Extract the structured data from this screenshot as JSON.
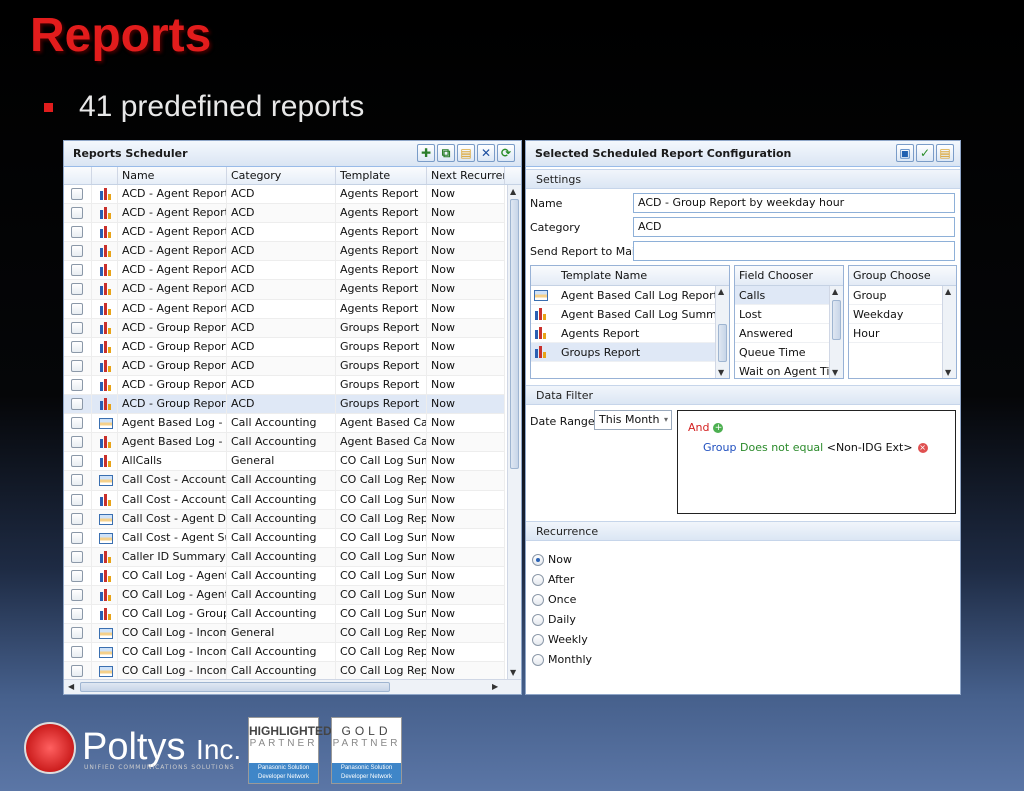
{
  "slide": {
    "title": "Reports",
    "bullet": "41 predefined reports"
  },
  "scheduler": {
    "title": "Reports Scheduler",
    "columns": [
      "Name",
      "Category",
      "Template",
      "Next Recurren"
    ],
    "rows": [
      {
        "name": "ACD - Agent Report",
        "category": "ACD",
        "template": "Agents Report",
        "next": "Now",
        "icon": "chart-icon"
      },
      {
        "name": "ACD - Agent Report",
        "category": "ACD",
        "template": "Agents Report",
        "next": "Now",
        "icon": "chart-icon"
      },
      {
        "name": "ACD - Agent Report",
        "category": "ACD",
        "template": "Agents Report",
        "next": "Now",
        "icon": "chart-icon"
      },
      {
        "name": "ACD - Agent Report",
        "category": "ACD",
        "template": "Agents Report",
        "next": "Now",
        "icon": "chart-icon"
      },
      {
        "name": "ACD - Agent Report",
        "category": "ACD",
        "template": "Agents Report",
        "next": "Now",
        "icon": "chart-icon"
      },
      {
        "name": "ACD - Agent Report",
        "category": "ACD",
        "template": "Agents Report",
        "next": "Now",
        "icon": "chart-icon"
      },
      {
        "name": "ACD - Agent Report",
        "category": "ACD",
        "template": "Agents Report",
        "next": "Now",
        "icon": "chart-icon"
      },
      {
        "name": "ACD - Group Report",
        "category": "ACD",
        "template": "Groups Report",
        "next": "Now",
        "icon": "chart-icon"
      },
      {
        "name": "ACD - Group Report",
        "category": "ACD",
        "template": "Groups Report",
        "next": "Now",
        "icon": "chart-icon"
      },
      {
        "name": "ACD - Group Report",
        "category": "ACD",
        "template": "Groups Report",
        "next": "Now",
        "icon": "chart-icon"
      },
      {
        "name": "ACD - Group Report",
        "category": "ACD",
        "template": "Groups Report",
        "next": "Now",
        "icon": "chart-icon"
      },
      {
        "name": "ACD - Group Report",
        "category": "ACD",
        "template": "Groups Report",
        "next": "Now",
        "icon": "chart-icon",
        "selected": true
      },
      {
        "name": "Agent Based Log - I",
        "category": "Call Accounting",
        "template": "Agent Based Cal",
        "next": "Now",
        "icon": "report-icon"
      },
      {
        "name": "Agent Based Log - I",
        "category": "Call Accounting",
        "template": "Agent Based Cal",
        "next": "Now",
        "icon": "chart-icon"
      },
      {
        "name": "AllCalls",
        "category": "General",
        "template": "CO Call Log Sum",
        "next": "Now",
        "icon": "chart-icon"
      },
      {
        "name": "Call Cost - Account I",
        "category": "Call Accounting",
        "template": "CO Call Log Rep",
        "next": "Now",
        "icon": "report-icon"
      },
      {
        "name": "Call Cost - Account S",
        "category": "Call Accounting",
        "template": "CO Call Log Sum",
        "next": "Now",
        "icon": "chart-icon"
      },
      {
        "name": "Call Cost - Agent De",
        "category": "Call Accounting",
        "template": "CO Call Log Rep",
        "next": "Now",
        "icon": "report-icon"
      },
      {
        "name": "Call Cost - Agent Su",
        "category": "Call Accounting",
        "template": "CO Call Log Sum",
        "next": "Now",
        "icon": "report-icon"
      },
      {
        "name": "Caller ID Summary",
        "category": "Call Accounting",
        "template": "CO Call Log Sum",
        "next": "Now",
        "icon": "chart-icon"
      },
      {
        "name": "CO Call Log - Agent",
        "category": "Call Accounting",
        "template": "CO Call Log Sum",
        "next": "Now",
        "icon": "chart-icon"
      },
      {
        "name": "CO Call Log - Agent",
        "category": "Call Accounting",
        "template": "CO Call Log Sum",
        "next": "Now",
        "icon": "chart-icon"
      },
      {
        "name": "CO Call Log - Group",
        "category": "Call Accounting",
        "template": "CO Call Log Sum",
        "next": "Now",
        "icon": "chart-icon"
      },
      {
        "name": "CO Call Log - Incom",
        "category": "General",
        "template": "CO Call Log Rep",
        "next": "Now",
        "icon": "report-icon"
      },
      {
        "name": "CO Call Log - Incom",
        "category": "Call Accounting",
        "template": "CO Call Log Rep",
        "next": "Now",
        "icon": "report-icon"
      },
      {
        "name": "CO Call Log - Incom",
        "category": "Call Accounting",
        "template": "CO Call Log Rep",
        "next": "Now",
        "icon": "report-icon"
      }
    ]
  },
  "config": {
    "title": "Selected Scheduled Report Configuration",
    "settings_label": "Settings",
    "name_label": "Name",
    "name_value": "ACD - Group Report by weekday hour",
    "category_label": "Category",
    "category_value": "ACD",
    "mail_label": "Send Report to Mail",
    "mail_value": "",
    "template_header": "Template Name",
    "templates": [
      {
        "label": "Agent Based Call Log Report",
        "icon": "report-icon"
      },
      {
        "label": "Agent Based Call Log Summa",
        "icon": "chart-icon"
      },
      {
        "label": "Agents Report",
        "icon": "chart-icon"
      },
      {
        "label": "Groups Report",
        "icon": "chart-icon",
        "selected": true
      }
    ],
    "field_header": "Field Chooser",
    "fields": [
      "Calls",
      "Lost",
      "Answered",
      "Queue Time",
      "Wait on Agent Ti"
    ],
    "group_header": "Group Choose",
    "groups": [
      "Group",
      "Weekday",
      "Hour"
    ],
    "filter_label": "Data Filter",
    "date_range_label": "Date Range",
    "date_range_value": "This Month",
    "filter_and": "And",
    "filter_field": "Group",
    "filter_op": "Does not equal",
    "filter_value": "<Non-IDG Ext>",
    "recurrence_label": "Recurrence",
    "recurrence": [
      "Now",
      "After",
      "Once",
      "Daily",
      "Weekly",
      "Monthly"
    ],
    "recurrence_selected": "Now"
  },
  "footer": {
    "logo_name": "Poltys",
    "logo_suffix": "Inc.",
    "logo_tagline": "UNIFIED COMMUNICATIONS SOLUTIONS",
    "badge1_top": "HIGHLIGHTED",
    "badge1_mid": "PARTNER",
    "badge2_top": "GOLD",
    "badge2_mid": "PARTNER",
    "badge_bottom": "Panasonic Solution Developer Network"
  },
  "colors": {
    "title_red": "#e21c1c",
    "header_blue": "#15428b",
    "selection": "#dfe8f6"
  }
}
